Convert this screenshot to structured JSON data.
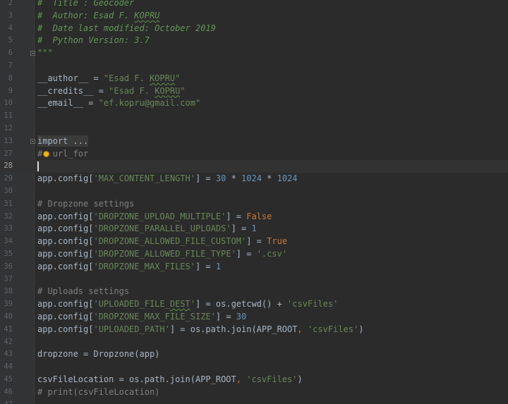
{
  "editor": {
    "lines": [
      {
        "n": "2",
        "segs": [
          {
            "t": "#  Title : Geocoder",
            "c": "doc"
          }
        ]
      },
      {
        "n": "3",
        "segs": [
          {
            "t": "#  Author: Esad F. ",
            "c": "doc"
          },
          {
            "t": "KOPRU",
            "c": "doc",
            "typo": true
          }
        ]
      },
      {
        "n": "4",
        "segs": [
          {
            "t": "#  Date last modified: October 2019",
            "c": "doc"
          }
        ]
      },
      {
        "n": "5",
        "segs": [
          {
            "t": "#  Python Version: 3.7",
            "c": "doc"
          }
        ]
      },
      {
        "n": "6",
        "fold": true,
        "segs": [
          {
            "t": "\"\"\"",
            "c": "doc"
          }
        ]
      },
      {
        "n": "7",
        "segs": []
      },
      {
        "n": "8",
        "segs": [
          {
            "t": "__author__ = ",
            "c": "plain"
          },
          {
            "t": "\"Esad F. ",
            "c": "str"
          },
          {
            "t": "KOPRU",
            "c": "str",
            "typo": true
          },
          {
            "t": "\"",
            "c": "str"
          }
        ]
      },
      {
        "n": "9",
        "segs": [
          {
            "t": "__credits__ = ",
            "c": "plain"
          },
          {
            "t": "\"Esad F. ",
            "c": "str"
          },
          {
            "t": "KOPRU",
            "c": "str",
            "typo": true
          },
          {
            "t": "\"",
            "c": "str"
          }
        ]
      },
      {
        "n": "10",
        "segs": [
          {
            "t": "__email__ = ",
            "c": "plain"
          },
          {
            "t": "\"ef.kopru@gmail.com\"",
            "c": "str"
          }
        ]
      },
      {
        "n": "11",
        "segs": []
      },
      {
        "n": "12",
        "segs": []
      },
      {
        "n": "13",
        "fold": true,
        "segs": [
          {
            "t": "import ...",
            "c": "folded"
          }
        ]
      },
      {
        "n": "27",
        "bulb": true,
        "segs": [
          {
            "t": "#",
            "c": "comment"
          },
          {
            "t": "  ",
            "c": "plain"
          },
          {
            "t": "url_for",
            "c": "comment"
          }
        ]
      },
      {
        "n": "28",
        "current": true,
        "caret": true,
        "segs": []
      },
      {
        "n": "29",
        "segs": [
          {
            "t": "app.config[",
            "c": "plain"
          },
          {
            "t": "'MAX_CONTENT_LENGTH'",
            "c": "str"
          },
          {
            "t": "] = ",
            "c": "plain"
          },
          {
            "t": "30",
            "c": "num"
          },
          {
            "t": " * ",
            "c": "plain"
          },
          {
            "t": "1024",
            "c": "num"
          },
          {
            "t": " * ",
            "c": "plain"
          },
          {
            "t": "1024",
            "c": "num"
          }
        ]
      },
      {
        "n": "30",
        "segs": []
      },
      {
        "n": "31",
        "segs": [
          {
            "t": "# Dropzone settings",
            "c": "comment"
          }
        ]
      },
      {
        "n": "32",
        "segs": [
          {
            "t": "app.config[",
            "c": "plain"
          },
          {
            "t": "'DROPZONE_UPLOAD_MULTIPLE'",
            "c": "str"
          },
          {
            "t": "] = ",
            "c": "plain"
          },
          {
            "t": "False",
            "c": "kw"
          }
        ]
      },
      {
        "n": "33",
        "segs": [
          {
            "t": "app.config[",
            "c": "plain"
          },
          {
            "t": "'DROPZONE_PARALLEL_UPLOADS'",
            "c": "str"
          },
          {
            "t": "] = ",
            "c": "plain"
          },
          {
            "t": "1",
            "c": "num"
          }
        ]
      },
      {
        "n": "34",
        "segs": [
          {
            "t": "app.config[",
            "c": "plain"
          },
          {
            "t": "'DROPZONE_ALLOWED_FILE_CUSTOM'",
            "c": "str"
          },
          {
            "t": "] = ",
            "c": "plain"
          },
          {
            "t": "True",
            "c": "kw"
          }
        ]
      },
      {
        "n": "35",
        "segs": [
          {
            "t": "app.config[",
            "c": "plain"
          },
          {
            "t": "'DROPZONE_ALLOWED_FILE_TYPE'",
            "c": "str"
          },
          {
            "t": "] = ",
            "c": "plain"
          },
          {
            "t": "'.csv'",
            "c": "str"
          }
        ]
      },
      {
        "n": "36",
        "segs": [
          {
            "t": "app.config[",
            "c": "plain"
          },
          {
            "t": "'DROPZONE_MAX_FILES'",
            "c": "str"
          },
          {
            "t": "] = ",
            "c": "plain"
          },
          {
            "t": "1",
            "c": "num"
          }
        ]
      },
      {
        "n": "37",
        "segs": []
      },
      {
        "n": "38",
        "segs": [
          {
            "t": "# Uploads settings",
            "c": "comment"
          }
        ]
      },
      {
        "n": "39",
        "segs": [
          {
            "t": "app.config[",
            "c": "plain"
          },
          {
            "t": "'UPLOADED_FILE_",
            "c": "str"
          },
          {
            "t": "DEST",
            "c": "str",
            "typo": true
          },
          {
            "t": "'",
            "c": "str"
          },
          {
            "t": "] = os.getcwd() + ",
            "c": "plain"
          },
          {
            "t": "'csvFiles'",
            "c": "str"
          }
        ]
      },
      {
        "n": "40",
        "segs": [
          {
            "t": "app.config[",
            "c": "plain"
          },
          {
            "t": "'DROPZONE_MAX_FILE_SIZE'",
            "c": "str"
          },
          {
            "t": "] = ",
            "c": "plain"
          },
          {
            "t": "30",
            "c": "num"
          }
        ]
      },
      {
        "n": "41",
        "segs": [
          {
            "t": "app.config[",
            "c": "plain"
          },
          {
            "t": "'UPLOADED_PATH'",
            "c": "str"
          },
          {
            "t": "] = os.path.join(APP_ROOT",
            "c": "plain"
          },
          {
            "t": ", ",
            "c": "kw"
          },
          {
            "t": "'csvFiles'",
            "c": "str"
          },
          {
            "t": ")",
            "c": "plain"
          }
        ]
      },
      {
        "n": "42",
        "segs": []
      },
      {
        "n": "43",
        "segs": [
          {
            "t": "dropzone = Dropzone(app)",
            "c": "plain"
          }
        ]
      },
      {
        "n": "44",
        "segs": []
      },
      {
        "n": "45",
        "segs": [
          {
            "t": "csvFileLocation = os.path.join(APP_ROOT",
            "c": "plain"
          },
          {
            "t": ", ",
            "c": "kw"
          },
          {
            "t": "'csvFiles'",
            "c": "str"
          },
          {
            "t": ")",
            "c": "plain"
          }
        ]
      },
      {
        "n": "46",
        "segs": [
          {
            "t": "# print(csvFileLocation)",
            "c": "comment"
          }
        ]
      },
      {
        "n": "47",
        "segs": []
      }
    ]
  }
}
